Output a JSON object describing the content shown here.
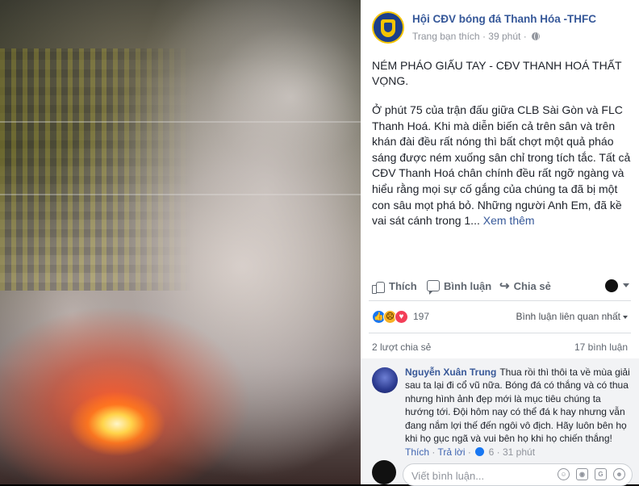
{
  "post": {
    "page_name": "Hội CĐV bóng đá Thanh Hóa -THFC",
    "meta_label": "Trang bạn thích",
    "meta_sep": "·",
    "time_ago": "39 phút",
    "title": "NÉM PHÁO GIẤU TAY - CĐV THANH HOÁ THẤT VỌNG.",
    "body": "Ở phút 75 của trận đấu giữa CLB Sài Gòn và FLC Thanh Hoá. Khi mà diễn biến cả trên sân và trên khán đài đều rất nóng thì bất chợt một quả pháo sáng được ném xuống sân chỉ trong tích tắc. Tất cả CĐV Thanh Hoá chân chính đều rất ngỡ ngàng và hiểu rằng mọi sự cố gắng của chúng ta đã bị một con sâu mọt phá bỏ. Những người Anh Em, đã kề vai sát cánh trong 1...",
    "see_more": "Xem thêm"
  },
  "actions": {
    "like": "Thích",
    "comment": "Bình luận",
    "share": "Chia sẻ"
  },
  "reactions": {
    "count": "197",
    "types": [
      "like",
      "sad",
      "love"
    ]
  },
  "sort_label": "Bình luận liên quan nhất",
  "stats": {
    "shares": "2 lượt chia sẻ",
    "comments": "17 bình luận"
  },
  "comment": {
    "author": "Nguyễn Xuân Trung",
    "text": "Thua rồi thì thôi ta về mùa giải sau ta lại đi cổ vũ nữa. Bóng đá có thắng và có thua nhưng hình ảnh đẹp mới là mục tiêu chúng ta hướng tới. Đội hôm nay có thể đá k hay nhưng vẫn đang nắm lợi thế đến ngôi vô địch. Hãy luôn bên họ khi họ gục ngã và vui bên họ khi họ chiến thắng!",
    "like": "Thích",
    "reply": "Trả lời",
    "sep": "·",
    "likes": "6",
    "time": "31 phút"
  },
  "composer": {
    "placeholder": "Viết bình luận..."
  },
  "icons": [
    "globe-icon",
    "like-icon",
    "comment-icon",
    "share-icon",
    "caret-down-icon",
    "emoji-icon",
    "camera-icon",
    "gif-icon",
    "sticker-icon"
  ]
}
